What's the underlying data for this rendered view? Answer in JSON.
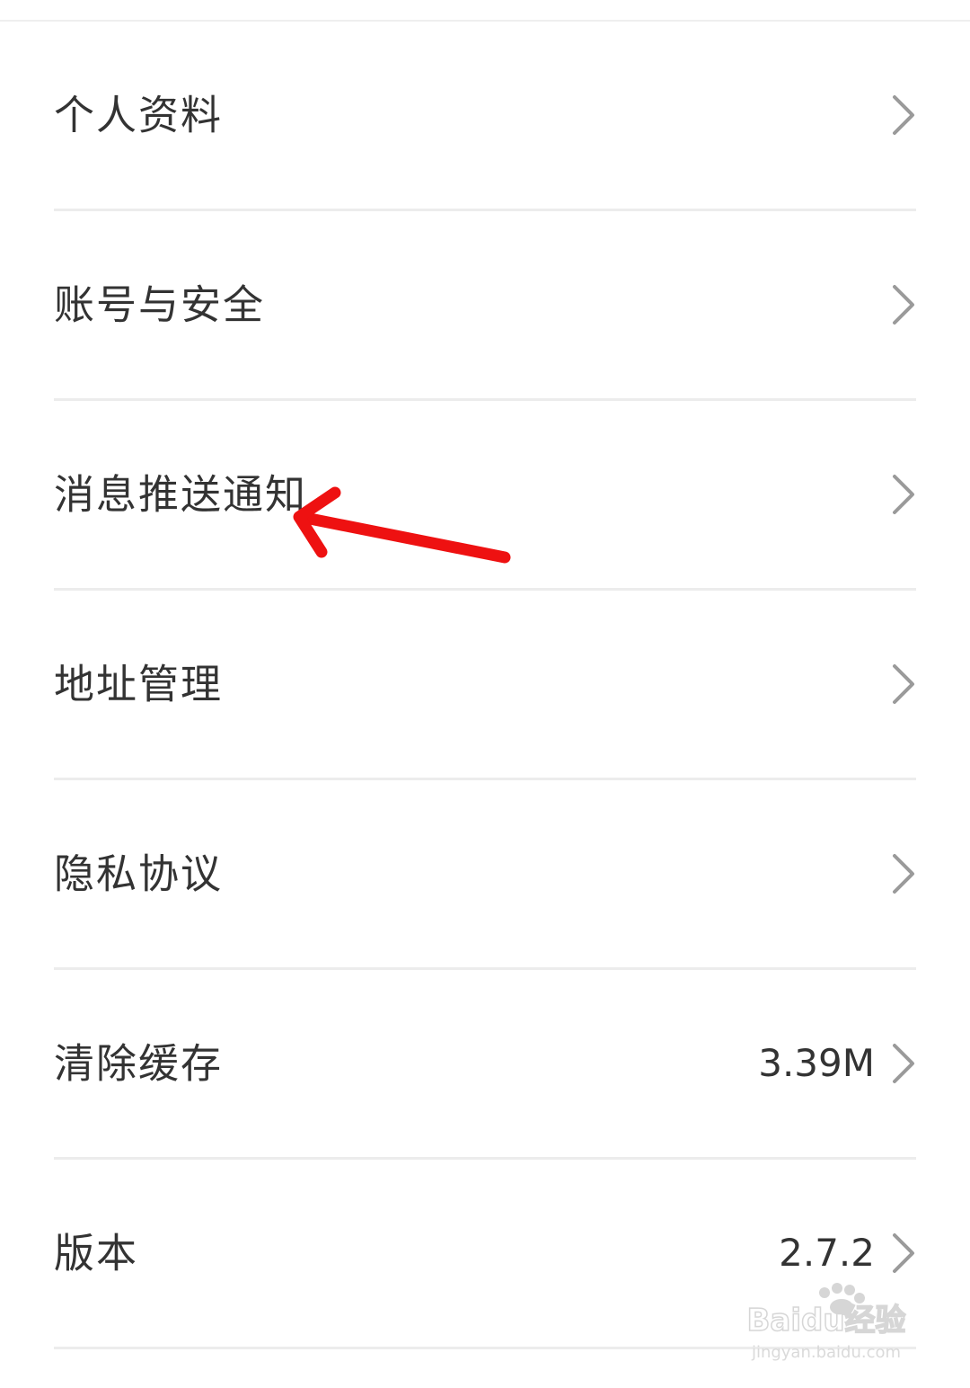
{
  "settings": {
    "items": [
      {
        "label": "个人资料",
        "value": ""
      },
      {
        "label": "账号与安全",
        "value": ""
      },
      {
        "label": "消息推送通知",
        "value": ""
      },
      {
        "label": "地址管理",
        "value": ""
      },
      {
        "label": "隐私协议",
        "value": ""
      },
      {
        "label": "清除缓存",
        "value": "3.39M"
      },
      {
        "label": "版本",
        "value": "2.7.2"
      }
    ]
  },
  "icons": {
    "chevron": "chevron-right-icon",
    "annotation": "red-arrow-annotation"
  },
  "colors": {
    "text": "#333333",
    "chevron": "#9a9a9a",
    "divider": "#ececec",
    "annotation": "#ee1111",
    "watermark": "#cfcfcf"
  },
  "watermark": {
    "brand": "Baidu经验",
    "url": "jingyan.baidu.com"
  }
}
